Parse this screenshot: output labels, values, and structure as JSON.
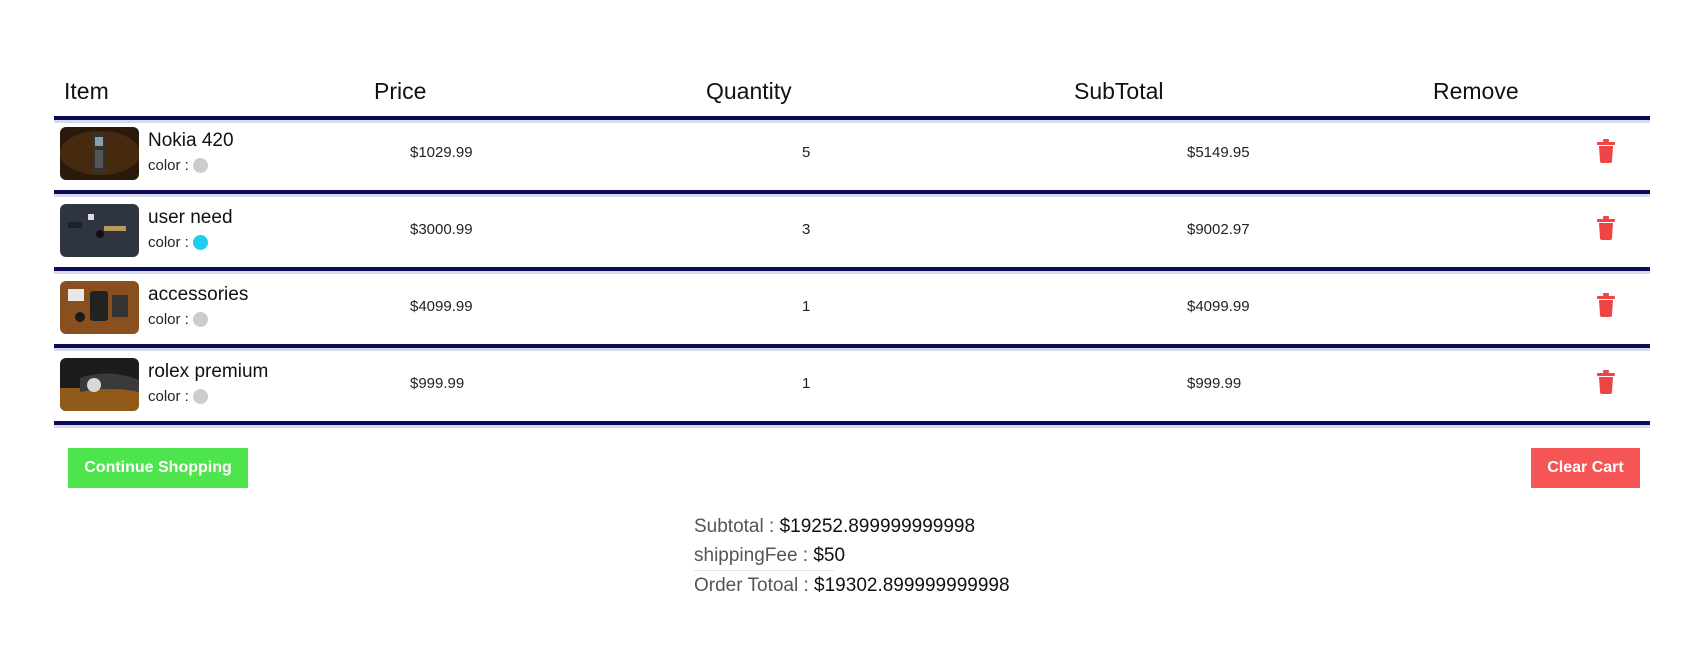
{
  "header": {
    "item": "Item",
    "price": "Price",
    "quantity": "Quantity",
    "subtotal": "SubTotal",
    "remove": "Remove"
  },
  "items": [
    {
      "name": "Nokia 420",
      "color_label": "color :",
      "color": "#cccccc",
      "price": "$1029.99",
      "quantity": "5",
      "subtotal": "$5149.95"
    },
    {
      "name": "user need",
      "color_label": "color :",
      "color": "#22ccee",
      "price": "$3000.99",
      "quantity": "3",
      "subtotal": "$9002.97"
    },
    {
      "name": "accessories",
      "color_label": "color :",
      "color": "#cccccc",
      "price": "$4099.99",
      "quantity": "1",
      "subtotal": "$4099.99"
    },
    {
      "name": "rolex premium",
      "color_label": "color :",
      "color": "#cccccc",
      "price": "$999.99",
      "quantity": "1",
      "subtotal": "$999.99"
    }
  ],
  "actions": {
    "continue_label": "Continue Shopping",
    "clear_label": "Clear Cart"
  },
  "totals": {
    "subtotal_label": "Subtotal :",
    "subtotal_value": "$19252.899999999998",
    "shipping_label": "shippingFee :",
    "shipping_value": "$50",
    "order_label": "Order Totoal :",
    "order_value": "$19302.899999999998"
  },
  "colors": {
    "continue_bg": "#4ee44e",
    "clear_bg": "#f55555",
    "trash": "#ee4444",
    "divider": "#0b0b5a"
  },
  "icons": {
    "remove": "trash-icon"
  }
}
